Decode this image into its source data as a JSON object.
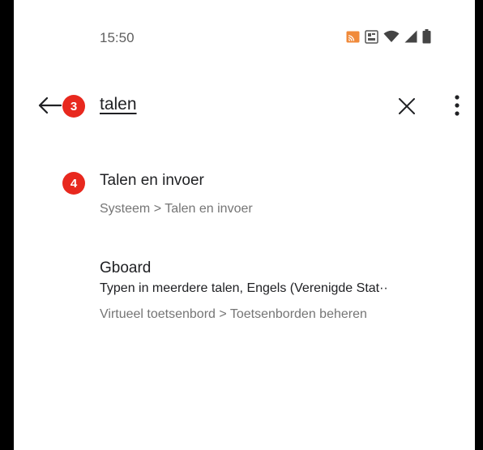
{
  "status_bar": {
    "time": "15:50",
    "icons": [
      "cast-icon",
      "sim-lte-icon",
      "wifi-icon",
      "signal-icon",
      "battery-icon"
    ]
  },
  "search": {
    "query": "talen",
    "back_icon": "arrow-left-icon",
    "clear_icon": "close-icon",
    "menu_icon": "more-vert-icon"
  },
  "step_badges": {
    "back": "3",
    "first_result": "4",
    "color": "#e8281e"
  },
  "results": [
    {
      "title": "Talen en invoer",
      "path": "Systeem > Talen en invoer"
    },
    {
      "title": "Gboard",
      "summary": "Typen in meerdere talen, Engels (Verenigde Stat··",
      "path": "Virtueel toetsenbord > Toetsenborden beheren"
    }
  ]
}
